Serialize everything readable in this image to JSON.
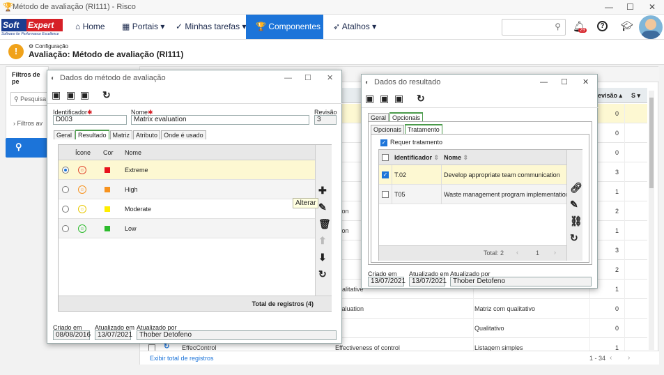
{
  "window": {
    "title": "Método de avaliação (RI111) - Risco"
  },
  "logo": {
    "part1": "Soft",
    "part2": "Expert",
    "slogan": "Software for Performance Excellence"
  },
  "nav": {
    "items": [
      {
        "label": "Home"
      },
      {
        "label": "Portais"
      },
      {
        "label": "Minhas tarefas"
      },
      {
        "label": "Componentes"
      },
      {
        "label": "Atalhos"
      }
    ],
    "notification_count": "29"
  },
  "header": {
    "breadcrumb": "Configuração",
    "title": "Avaliação: Método de avaliação (RI111)"
  },
  "left_panel": {
    "title": "Filtros de pe",
    "search_placeholder": "Pesquisa",
    "filters_label": "Filtros av"
  },
  "background_grid": {
    "header_cols": [
      "evisão",
      "S"
    ],
    "rows": [
      {
        "mid": "",
        "col2": "",
        "rev": "0"
      },
      {
        "mid": "co",
        "col2": "",
        "rev": "0"
      },
      {
        "mid": "co",
        "col2": "",
        "rev": "0"
      },
      {
        "mid": "",
        "col2": "",
        "rev": "3"
      },
      {
        "mid": "",
        "col2": "",
        "rev": "1"
      },
      {
        "mid": "ation",
        "col2": "",
        "rev": "2"
      },
      {
        "mid": "ation",
        "col2": "",
        "rev": "1"
      },
      {
        "mid": "",
        "col2": "",
        "rev": "3"
      },
      {
        "mid": "",
        "col2": "",
        "rev": "2"
      },
      {
        "mid": "qualitative",
        "col2": "",
        "rev": "1"
      },
      {
        "mid": "evaluation",
        "col2": "Matriz com qualitativo",
        "rev": "0"
      },
      {
        "mid": "d",
        "col2": "Qualitativo",
        "rev": "0"
      },
      {
        "mid": "Effectiveness of control",
        "col2": "Listagem simples",
        "rev": "1"
      }
    ],
    "last_row_id": "EffecControl",
    "show_total_link": "Exibir total de registros",
    "pager": "1 - 34"
  },
  "dialog1": {
    "title": "Dados do método de avaliação",
    "identifier_label": "Identificador",
    "identifier_value": "D003",
    "name_label": "Nome",
    "name_value": "Matrix evaluation",
    "revision_label": "Revisão",
    "revision_value": "3",
    "tabs": [
      "Geral",
      "Resultado",
      "Matriz",
      "Atributo",
      "Onde é usado"
    ],
    "grid_cols": [
      "Ícone",
      "Cor",
      "Nome"
    ],
    "rows": [
      {
        "name": "Extreme",
        "color": "#e8121b",
        "face": "#e24a33",
        "selected": true
      },
      {
        "name": "High",
        "color": "#f7931e",
        "face": "#f7931e",
        "selected": false
      },
      {
        "name": "Moderate",
        "color": "#ffee00",
        "face": "#e8c800",
        "selected": false
      },
      {
        "name": "Low",
        "color": "#2dbb2d",
        "face": "#2dbb2d",
        "selected": false
      }
    ],
    "total": "Total de registros (4)",
    "tooltip": "Alterar",
    "created_label": "Criado em",
    "created_value": "08/08/2016",
    "updated_label": "Atualizado em",
    "updated_value": "13/07/2021",
    "updated_by_label": "Atualizado por",
    "updated_by_value": "Thober Detofeno"
  },
  "dialog2": {
    "title": "Dados do resultado",
    "tabs": [
      "Geral",
      "Opcionais"
    ],
    "subtabs": [
      "Opcionais",
      "Tratamento"
    ],
    "requires_label": "Requer tratamento",
    "grid_cols": [
      "Identificador",
      "Nome"
    ],
    "rows": [
      {
        "id": "T.02",
        "name": "Develop appropriate team communication",
        "checked": true
      },
      {
        "id": "T05",
        "name": "Waste management program implementation",
        "checked": false
      }
    ],
    "total": "Total: 2",
    "page": "1",
    "created_label": "Criado em",
    "created_value": "13/07/2021",
    "updated_label": "Atualizado em",
    "updated_value": "13/07/2021",
    "updated_by_label": "Atualizado por",
    "updated_by_value": "Thober Detofeno"
  }
}
